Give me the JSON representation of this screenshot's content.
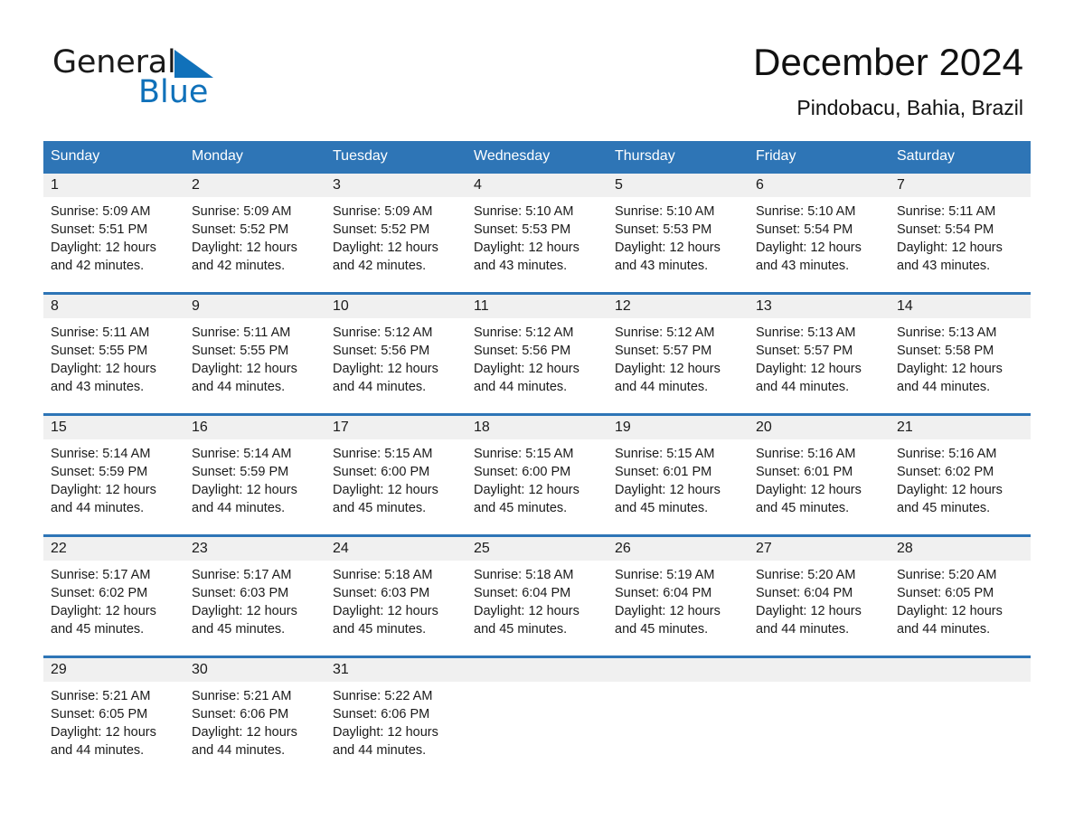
{
  "logo": {
    "word_general": "General",
    "word_blue": "Blue",
    "triangle_color": "#1071ba"
  },
  "header": {
    "title": "December 2024",
    "subtitle": "Pindobacu, Bahia, Brazil",
    "accent_color": "#2e75b6",
    "daynum_band_color": "#f0f0f0"
  },
  "weekdays": [
    "Sunday",
    "Monday",
    "Tuesday",
    "Wednesday",
    "Thursday",
    "Friday",
    "Saturday"
  ],
  "weeks": [
    {
      "days": [
        {
          "num": "1",
          "sunrise": "Sunrise: 5:09 AM",
          "sunset": "Sunset: 5:51 PM",
          "daylight": "Daylight: 12 hours and 42 minutes."
        },
        {
          "num": "2",
          "sunrise": "Sunrise: 5:09 AM",
          "sunset": "Sunset: 5:52 PM",
          "daylight": "Daylight: 12 hours and 42 minutes."
        },
        {
          "num": "3",
          "sunrise": "Sunrise: 5:09 AM",
          "sunset": "Sunset: 5:52 PM",
          "daylight": "Daylight: 12 hours and 42 minutes."
        },
        {
          "num": "4",
          "sunrise": "Sunrise: 5:10 AM",
          "sunset": "Sunset: 5:53 PM",
          "daylight": "Daylight: 12 hours and 43 minutes."
        },
        {
          "num": "5",
          "sunrise": "Sunrise: 5:10 AM",
          "sunset": "Sunset: 5:53 PM",
          "daylight": "Daylight: 12 hours and 43 minutes."
        },
        {
          "num": "6",
          "sunrise": "Sunrise: 5:10 AM",
          "sunset": "Sunset: 5:54 PM",
          "daylight": "Daylight: 12 hours and 43 minutes."
        },
        {
          "num": "7",
          "sunrise": "Sunrise: 5:11 AM",
          "sunset": "Sunset: 5:54 PM",
          "daylight": "Daylight: 12 hours and 43 minutes."
        }
      ]
    },
    {
      "days": [
        {
          "num": "8",
          "sunrise": "Sunrise: 5:11 AM",
          "sunset": "Sunset: 5:55 PM",
          "daylight": "Daylight: 12 hours and 43 minutes."
        },
        {
          "num": "9",
          "sunrise": "Sunrise: 5:11 AM",
          "sunset": "Sunset: 5:55 PM",
          "daylight": "Daylight: 12 hours and 44 minutes."
        },
        {
          "num": "10",
          "sunrise": "Sunrise: 5:12 AM",
          "sunset": "Sunset: 5:56 PM",
          "daylight": "Daylight: 12 hours and 44 minutes."
        },
        {
          "num": "11",
          "sunrise": "Sunrise: 5:12 AM",
          "sunset": "Sunset: 5:56 PM",
          "daylight": "Daylight: 12 hours and 44 minutes."
        },
        {
          "num": "12",
          "sunrise": "Sunrise: 5:12 AM",
          "sunset": "Sunset: 5:57 PM",
          "daylight": "Daylight: 12 hours and 44 minutes."
        },
        {
          "num": "13",
          "sunrise": "Sunrise: 5:13 AM",
          "sunset": "Sunset: 5:57 PM",
          "daylight": "Daylight: 12 hours and 44 minutes."
        },
        {
          "num": "14",
          "sunrise": "Sunrise: 5:13 AM",
          "sunset": "Sunset: 5:58 PM",
          "daylight": "Daylight: 12 hours and 44 minutes."
        }
      ]
    },
    {
      "days": [
        {
          "num": "15",
          "sunrise": "Sunrise: 5:14 AM",
          "sunset": "Sunset: 5:59 PM",
          "daylight": "Daylight: 12 hours and 44 minutes."
        },
        {
          "num": "16",
          "sunrise": "Sunrise: 5:14 AM",
          "sunset": "Sunset: 5:59 PM",
          "daylight": "Daylight: 12 hours and 44 minutes."
        },
        {
          "num": "17",
          "sunrise": "Sunrise: 5:15 AM",
          "sunset": "Sunset: 6:00 PM",
          "daylight": "Daylight: 12 hours and 45 minutes."
        },
        {
          "num": "18",
          "sunrise": "Sunrise: 5:15 AM",
          "sunset": "Sunset: 6:00 PM",
          "daylight": "Daylight: 12 hours and 45 minutes."
        },
        {
          "num": "19",
          "sunrise": "Sunrise: 5:15 AM",
          "sunset": "Sunset: 6:01 PM",
          "daylight": "Daylight: 12 hours and 45 minutes."
        },
        {
          "num": "20",
          "sunrise": "Sunrise: 5:16 AM",
          "sunset": "Sunset: 6:01 PM",
          "daylight": "Daylight: 12 hours and 45 minutes."
        },
        {
          "num": "21",
          "sunrise": "Sunrise: 5:16 AM",
          "sunset": "Sunset: 6:02 PM",
          "daylight": "Daylight: 12 hours and 45 minutes."
        }
      ]
    },
    {
      "days": [
        {
          "num": "22",
          "sunrise": "Sunrise: 5:17 AM",
          "sunset": "Sunset: 6:02 PM",
          "daylight": "Daylight: 12 hours and 45 minutes."
        },
        {
          "num": "23",
          "sunrise": "Sunrise: 5:17 AM",
          "sunset": "Sunset: 6:03 PM",
          "daylight": "Daylight: 12 hours and 45 minutes."
        },
        {
          "num": "24",
          "sunrise": "Sunrise: 5:18 AM",
          "sunset": "Sunset: 6:03 PM",
          "daylight": "Daylight: 12 hours and 45 minutes."
        },
        {
          "num": "25",
          "sunrise": "Sunrise: 5:18 AM",
          "sunset": "Sunset: 6:04 PM",
          "daylight": "Daylight: 12 hours and 45 minutes."
        },
        {
          "num": "26",
          "sunrise": "Sunrise: 5:19 AM",
          "sunset": "Sunset: 6:04 PM",
          "daylight": "Daylight: 12 hours and 45 minutes."
        },
        {
          "num": "27",
          "sunrise": "Sunrise: 5:20 AM",
          "sunset": "Sunset: 6:04 PM",
          "daylight": "Daylight: 12 hours and 44 minutes."
        },
        {
          "num": "28",
          "sunrise": "Sunrise: 5:20 AM",
          "sunset": "Sunset: 6:05 PM",
          "daylight": "Daylight: 12 hours and 44 minutes."
        }
      ]
    },
    {
      "days": [
        {
          "num": "29",
          "sunrise": "Sunrise: 5:21 AM",
          "sunset": "Sunset: 6:05 PM",
          "daylight": "Daylight: 12 hours and 44 minutes."
        },
        {
          "num": "30",
          "sunrise": "Sunrise: 5:21 AM",
          "sunset": "Sunset: 6:06 PM",
          "daylight": "Daylight: 12 hours and 44 minutes."
        },
        {
          "num": "31",
          "sunrise": "Sunrise: 5:22 AM",
          "sunset": "Sunset: 6:06 PM",
          "daylight": "Daylight: 12 hours and 44 minutes."
        },
        {
          "num": "",
          "sunrise": "",
          "sunset": "",
          "daylight": ""
        },
        {
          "num": "",
          "sunrise": "",
          "sunset": "",
          "daylight": ""
        },
        {
          "num": "",
          "sunrise": "",
          "sunset": "",
          "daylight": ""
        },
        {
          "num": "",
          "sunrise": "",
          "sunset": "",
          "daylight": ""
        }
      ]
    }
  ]
}
